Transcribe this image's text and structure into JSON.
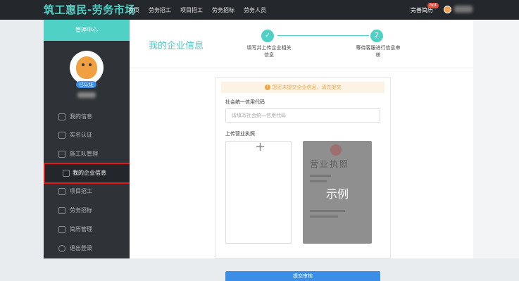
{
  "header": {
    "logo": "筑工惠民-劳务市场",
    "nav": [
      "首页",
      "劳务招工",
      "项目招工",
      "劳务招标",
      "劳务人员"
    ],
    "resume_label": "完善简历",
    "hot_badge": "hot"
  },
  "sidebar": {
    "title": "管理中心",
    "verified_badge": "已认证",
    "items": [
      {
        "label": "我的信息",
        "icon": "user-icon"
      },
      {
        "label": "实名认证",
        "icon": "bookmark-icon"
      },
      {
        "label": "施工队管理",
        "icon": "team-icon"
      },
      {
        "label": "我的企业信息",
        "icon": "building-icon",
        "active": true
      },
      {
        "label": "项目招工",
        "icon": "project-icon"
      },
      {
        "label": "劳务招标",
        "icon": "bid-icon"
      },
      {
        "label": "简历管理",
        "icon": "resume-icon"
      },
      {
        "label": "退出登录",
        "icon": "power-icon"
      }
    ]
  },
  "main": {
    "title": "我的企业信息",
    "steps": [
      {
        "num": "",
        "label": "填写并上传企业相关信息"
      },
      {
        "num": "2",
        "label": "等待客服进行信息审核"
      }
    ],
    "notice": "您还未提交企业信息，请先提交",
    "credit_code_label": "社会统一信用代码",
    "credit_code_placeholder": "请填写社会统一信用代码",
    "license_label": "上传营业执照",
    "sample_title": "营业执照",
    "sample_label": "示例",
    "submit_label": "提交审核"
  },
  "annotation": {
    "color": "#e31b1b"
  }
}
